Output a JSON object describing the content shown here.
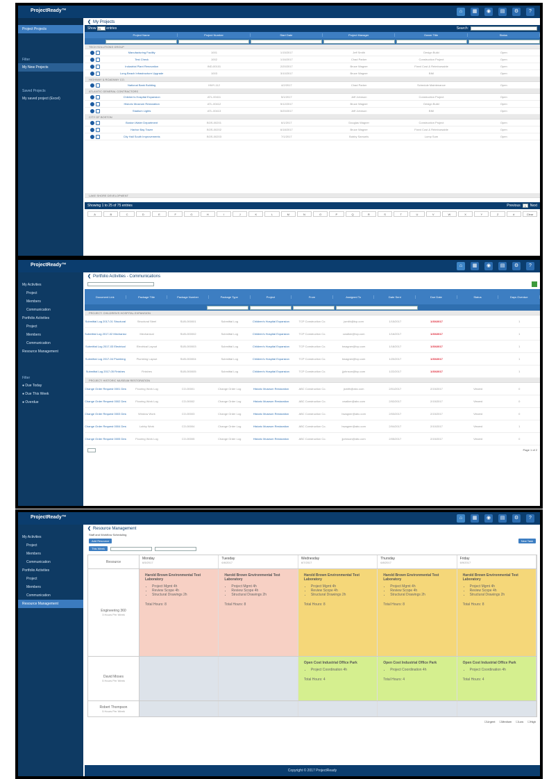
{
  "brand": "ProjectReady™",
  "panel1": {
    "breadcrumb": "My Projects",
    "show_label": "Show",
    "show_value": "25",
    "entries_label": "entries",
    "search_label": "Search:",
    "sidebar": {
      "items": [
        "Project Projects"
      ],
      "filters_head": "Filter",
      "filter_item": "My New Projects",
      "saved_head": "Saved Projects",
      "saved_item": "My saved project (Excel)"
    },
    "columns": [
      "Project Name",
      "Project Number",
      "Start Date",
      "Project Manager",
      "Owner Title",
      "Status"
    ],
    "groups": [
      {
        "label": "TECH SOLUTIONS GROUP",
        "rows": [
          [
            "Manufacturing Facility",
            "1001",
            "1/15/2017",
            "Jeff Smith",
            "Design Build",
            "Open"
          ],
          [
            "Test Check",
            "1002",
            "1/16/2017",
            "Chad Parker",
            "Construction Project",
            "Open"
          ],
          [
            "Industrial Plant Renovation",
            "IND-00101",
            "2/20/2017",
            "Bruce Wagner",
            "Fixed Cost & Reimbursable",
            "Open"
          ],
          [
            "Long Beach Infrastructure Upgrade",
            "1003",
            "3/10/2017",
            "Bruce Wagner",
            "BIM",
            "Open"
          ]
        ]
      },
      {
        "label": "HIGHWAY & ROADWAY CO.",
        "rows": [
          [
            "National Bank Building",
            "HWY-112",
            "4/2/2017",
            "Chad Parker",
            "Schedule Maintenance",
            "Open"
          ]
        ]
      },
      {
        "label": "ATLANTIC GENERAL CONTRACTORS",
        "rows": [
          [
            "Children's Hospital Expansion",
            "ATL-00411",
            "5/1/2017",
            "Jeff Johnson",
            "Construction Project",
            "Open"
          ],
          [
            "Historic Museum Restoration",
            "ATL-00412",
            "5/12/2017",
            "Bruce Wagner",
            "Design Build",
            "Open"
          ],
          [
            "Stadium Lights",
            "ATL-00413",
            "5/20/2017",
            "Jeff Johnson",
            "BIM",
            "Open"
          ]
        ]
      },
      {
        "label": "CITY OF BOSTON",
        "rows": [
          [
            "Boston Water Department",
            "BOS-00201",
            "6/1/2017",
            "Douglas Wagner",
            "Construction Project",
            "Open"
          ],
          [
            "Harbor Bay Tower",
            "BOS-00202",
            "6/18/2017",
            "Bruce Wagner",
            "Fixed Cost & Reimbursable",
            "Open"
          ],
          [
            "City Hall South Improvements",
            "BOS-00203",
            "7/1/2017",
            "Bobby Samuels",
            "Lump Sum",
            "Open"
          ]
        ]
      }
    ],
    "footer_group": "LAKE SHORE DEVELOPMENT",
    "showing": "Showing 1 to 25 of 75 entries",
    "pager_prev": "Previous",
    "pager_page": "1",
    "pager_next": "Next",
    "alpha": [
      "A",
      "B",
      "C",
      "D",
      "E",
      "F",
      "G",
      "H",
      "I",
      "J",
      "K",
      "L",
      "M",
      "N",
      "O",
      "P",
      "Q",
      "R",
      "S",
      "T",
      "U",
      "V",
      "W",
      "X",
      "Y",
      "Z",
      "#",
      "Clear"
    ]
  },
  "panel2": {
    "breadcrumb": "Portfolio Activities - Communications",
    "sidebar": {
      "items": [
        {
          "label": "My Activities",
          "level": 0
        },
        {
          "label": "Project",
          "level": 1
        },
        {
          "label": "Members",
          "level": 1
        },
        {
          "label": "Communication",
          "level": 1
        },
        {
          "label": "Portfolio Activities",
          "level": 0
        },
        {
          "label": "Project",
          "level": 1
        },
        {
          "label": "Members",
          "level": 1
        },
        {
          "label": "Communication",
          "level": 1,
          "active": true
        },
        {
          "label": "Resource Management",
          "level": 0
        }
      ],
      "filters_head": "Filter",
      "filters": [
        "Due Today",
        "Due This Week",
        "Overdue"
      ]
    },
    "columns": [
      "Document Link",
      "Package Title",
      "Package Number",
      "Package Type",
      "Project",
      "From",
      "Assigned To",
      "Date Sent",
      "Due Date",
      "Status",
      "Days Overdue"
    ],
    "group1": "PROJECT: CHILDREN'S HOSPITAL EXPANSION",
    "group2": "PROJECT: HISTORIC MUSEUM RESTORATION",
    "rows": [
      [
        "Submittal Log 2017-01 Structural",
        "Structural Steel",
        "SUB-000001",
        "Submittal Log",
        "Children's Hospital Expansion",
        "TCP Construction Co.",
        "jsmith@tcp.com",
        "1/15/2017",
        "1/30/2017",
        "",
        "1"
      ],
      [
        "Submittal Log 2017-02 Mechanical",
        "Mechanical",
        "SUB-000002",
        "Submittal Log",
        "Children's Hospital Expansion",
        "TCP Construction Co.",
        "cwalker@tcp.com",
        "1/16/2017",
        "1/30/2017",
        "",
        "1"
      ],
      [
        "Submittal Log 2017-03 Electrical",
        "Electrical Layout",
        "SUB-000003",
        "Submittal Log",
        "Children's Hospital Expansion",
        "TCP Construction Co.",
        "bwagner@tcp.com",
        "1/18/2017",
        "1/30/2017",
        "",
        "1"
      ],
      [
        "Submittal Log 2017-04 Plumbing",
        "Plumbing Layout",
        "SUB-000004",
        "Submittal Log",
        "Children's Hospital Expansion",
        "TCP Construction Co.",
        "bwagner@tcp.com",
        "1/20/2017",
        "1/30/2017",
        "",
        "1"
      ],
      [
        "Submittal Log 2017-05 Finishes",
        "Finishes",
        "SUB-000005",
        "Submittal Log",
        "Children's Hospital Expansion",
        "TCP Construction Co.",
        "jjohnson@tcp.com",
        "1/22/2017",
        "1/30/2017",
        "",
        "1"
      ],
      [
        "Change Order Request 0001 Design",
        "Flooring Work Log",
        "CO-00001",
        "Change Order Log",
        "Historic Museum Restoration",
        "ABC Construction Co.",
        "jsmith@abc.com",
        "2/01/2017",
        "2/15/2017",
        "Viewed",
        "0"
      ],
      [
        "Change Order Request 0002 Design",
        "Flooring Work Log",
        "CO-00002",
        "Change Order Log",
        "Historic Museum Restoration",
        "ABC Construction Co.",
        "cwalker@abc.com",
        "2/02/2017",
        "2/15/2017",
        "Viewed",
        "0"
      ],
      [
        "Change Order Request 0003 Design",
        "Window Work",
        "CO-00003",
        "Change Order Log",
        "Historic Museum Restoration",
        "ABC Construction Co.",
        "bwagner@abc.com",
        "2/03/2017",
        "2/15/2017",
        "Viewed",
        "0"
      ],
      [
        "Change Order Request 0004 Design",
        "Lobby Work",
        "CO-00004",
        "Change Order Log",
        "Historic Museum Restoration",
        "ABC Construction Co.",
        "bwagner@abc.com",
        "2/04/2017",
        "2/10/2017",
        "Viewed",
        "1"
      ],
      [
        "Change Order Request 0005 Design",
        "Flooring Work Log",
        "CO-00005",
        "Change Order Log",
        "Historic Museum Restoration",
        "ABC Construction Co.",
        "jjohnson@abc.com",
        "2/05/2017",
        "2/15/2017",
        "Viewed",
        "0"
      ]
    ],
    "pager": "Page 1 of 2"
  },
  "panel3": {
    "breadcrumb": "Resource Management",
    "subtitle": "Staff and Workflow Scheduling",
    "add_button": "Add Resource",
    "new_button": "New Task",
    "week_label": "This Week",
    "days": [
      {
        "name": "Monday",
        "date": "6/5/2017"
      },
      {
        "name": "Tuesday",
        "date": "6/6/2017"
      },
      {
        "name": "Wednesday",
        "date": "6/7/2017"
      },
      {
        "name": "Thursday",
        "date": "6/8/2017"
      },
      {
        "name": "Friday",
        "date": "6/9/2017"
      }
    ],
    "resource_head": "Resource",
    "resources": [
      {
        "name": "Engineering 360",
        "sub": "3 Hours Per Week"
      },
      {
        "name": "David Moses",
        "sub": "5 Hours Per Week"
      },
      {
        "name": "Robert Thompson",
        "sub": "5 Hours Per Week"
      }
    ],
    "task_a": {
      "title": "Harold Brown Environmental Test Laboratory",
      "items": [
        "Project Mgmt 4h",
        "Review Scope 4h",
        "Structural Drawings 2h"
      ],
      "hours": "Total Hours: 8"
    },
    "task_b": {
      "title": "Open Cost Industrial Office Park",
      "items": [
        "Project Coordination 4h"
      ],
      "hours": "Total Hours: 4"
    },
    "legend": [
      "Urgent",
      "Medium",
      "Low",
      "High"
    ],
    "footer": "Copyright © 2017 ProjectReady"
  }
}
